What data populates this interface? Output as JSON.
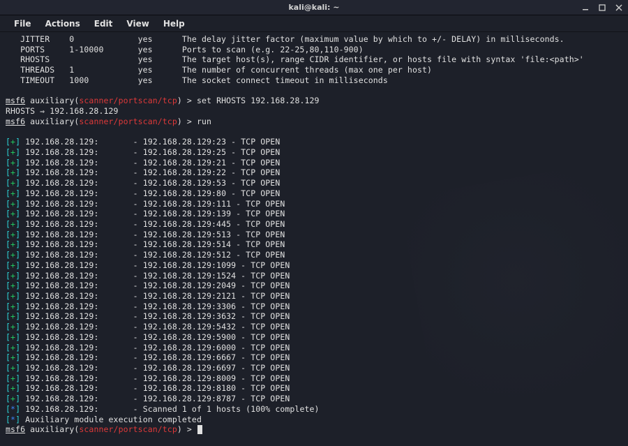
{
  "window": {
    "title": "kali@kali: ~"
  },
  "menu": {
    "file": "File",
    "actions": "Actions",
    "edit": "Edit",
    "view": "View",
    "help": "Help"
  },
  "options_table": [
    {
      "name": "JITTER",
      "current": "0",
      "req": "yes",
      "desc": "The delay jitter factor (maximum value by which to +/- DELAY) in milliseconds."
    },
    {
      "name": "PORTS",
      "current": "1-10000",
      "req": "yes",
      "desc": "Ports to scan (e.g. 22-25,80,110-900)"
    },
    {
      "name": "RHOSTS",
      "current": "",
      "req": "yes",
      "desc": "The target host(s), range CIDR identifier, or hosts file with syntax 'file:<path>'"
    },
    {
      "name": "THREADS",
      "current": "1",
      "req": "yes",
      "desc": "The number of concurrent threads (max one per host)"
    },
    {
      "name": "TIMEOUT",
      "current": "1000",
      "req": "yes",
      "desc": "The socket connect timeout in milliseconds"
    }
  ],
  "prompt": {
    "underline": "msf6",
    "aux": " auxiliary(",
    "module": "scanner/portscan/tcp",
    "close": ") > "
  },
  "cmds": {
    "set_rhosts": "set RHOSTS 192.168.28.129",
    "rhosts_echo": "RHOSTS ⇒ 192.168.28.129",
    "run": "run"
  },
  "scan": {
    "host": "192.168.28.129",
    "ports": [
      23,
      25,
      21,
      22,
      53,
      80,
      111,
      139,
      445,
      513,
      514,
      512,
      1099,
      1524,
      2049,
      2121,
      3306,
      3632,
      5432,
      5900,
      6000,
      6667,
      6697,
      8009,
      8180,
      8787
    ],
    "summary": "- Scanned 1 of 1 hosts (100% complete)",
    "complete": "Auxiliary module execution completed"
  }
}
